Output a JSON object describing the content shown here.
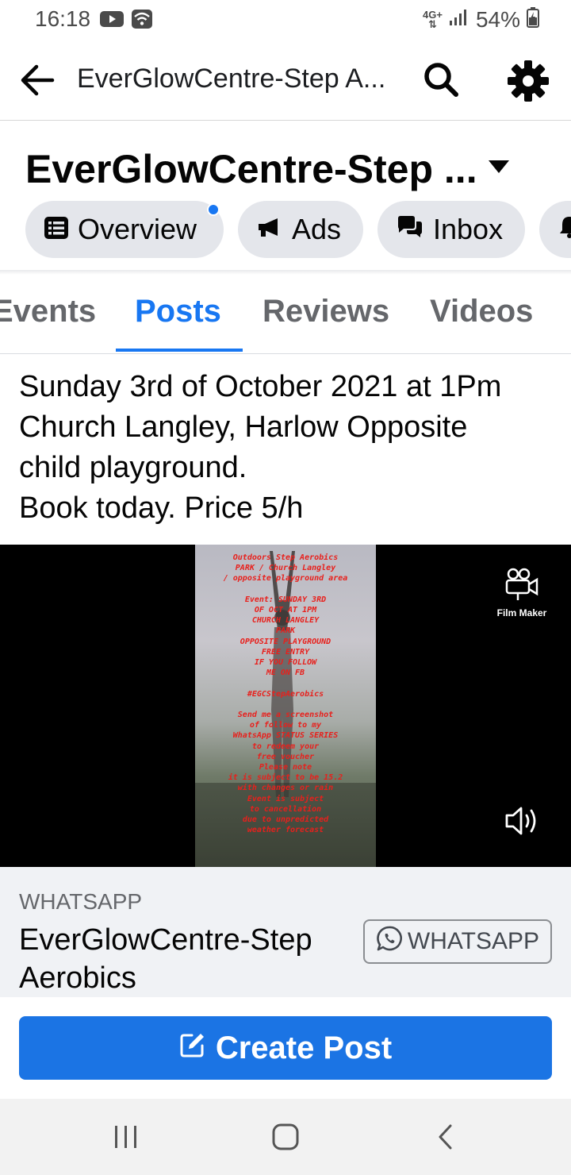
{
  "status_bar": {
    "time": "16:18",
    "network": "4G+",
    "battery": "54%",
    "icons": [
      "youtube-icon",
      "wifi-icon",
      "signal-icon",
      "battery-icon"
    ]
  },
  "header": {
    "title": "EverGlowCentre-Step A...",
    "icons": [
      "back-arrow-icon",
      "search-icon",
      "gear-icon"
    ]
  },
  "page": {
    "name": "EverGlowCentre-Step ..."
  },
  "pills": [
    {
      "label": "Overview",
      "icon": "list-icon",
      "notification_dot": true
    },
    {
      "label": "Ads",
      "icon": "megaphone-icon"
    },
    {
      "label": "Inbox",
      "icon": "chat-icon"
    },
    {
      "label": "",
      "icon": "bell-icon"
    }
  ],
  "tabs": [
    {
      "label": "Events",
      "active": false
    },
    {
      "label": "Posts",
      "active": true
    },
    {
      "label": "Reviews",
      "active": false
    },
    {
      "label": "Videos",
      "active": false
    }
  ],
  "post": {
    "lines": [
      "Sunday 3rd of October 2021 at 1Pm",
      "Church Langley, Harlow Opposite",
      "child playground.",
      "Book today. Price 5/h"
    ]
  },
  "video": {
    "overlay_lines": [
      "Outdoors Step Aerobics",
      "PARK / Church Langley",
      "/ opposite playground area",
      "",
      "Event: SUNDAY 3RD",
      "OF OCT AT 1PM",
      "CHURCH LANGLEY",
      "PARK",
      "OPPOSITE PLAYGROUND",
      "FREE ENTRY",
      "IF YOU FOLLOW",
      "ME ON FB",
      "",
      "#EGCStepAerobics",
      "",
      "Send me a screenshot",
      "of follow to my",
      "WhatsApp STATUS SERIES",
      "to redeem your",
      "free voucher",
      "Please note",
      "it is subject to be 15.2",
      "with changes or rain",
      "Event is subject",
      "to cancellation",
      "due to unpredicted",
      "weather forecast"
    ],
    "filmmaker_label": "Film Maker"
  },
  "attachment": {
    "kicker": "WHATSAPP",
    "title": "EverGlowCentre-Step Aerobics",
    "button_label": "WHATSAPP"
  },
  "create_post": {
    "label": "Create Post"
  },
  "nav": [
    "recent-apps-icon",
    "home-icon",
    "back-icon"
  ],
  "colors": {
    "accent": "#1877f2",
    "create_button": "#1b74e4",
    "pill_bg": "#e4e6eb",
    "overlay_text": "#e8201c"
  }
}
